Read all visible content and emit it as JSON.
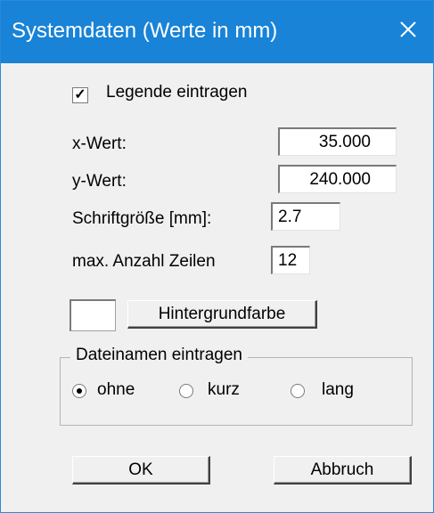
{
  "window": {
    "title": "Systemdaten (Werte in mm)"
  },
  "form": {
    "legend_checkbox": {
      "label": "Legende eintragen",
      "checked": true
    },
    "x_value": {
      "label": "x-Wert:",
      "value": "35.000"
    },
    "y_value": {
      "label": "y-Wert:",
      "value": "240.000"
    },
    "font_size": {
      "label": "Schriftgröße [mm]:",
      "value": "2.7"
    },
    "max_rows": {
      "label": "max. Anzahl Zeilen",
      "value": "12"
    },
    "background_color": {
      "button_label": "Hintergrundfarbe",
      "swatch_color": "#ffffff"
    },
    "filenames_group": {
      "title": "Dateinamen eintragen",
      "options": [
        {
          "label": "ohne",
          "selected": true
        },
        {
          "label": "kurz",
          "selected": false
        },
        {
          "label": "lang",
          "selected": false
        }
      ]
    }
  },
  "buttons": {
    "ok_label": "OK",
    "cancel_label": "Abbruch"
  },
  "colors": {
    "titlebar": "#1883d7",
    "dialog_bg": "#f0f0f0"
  }
}
